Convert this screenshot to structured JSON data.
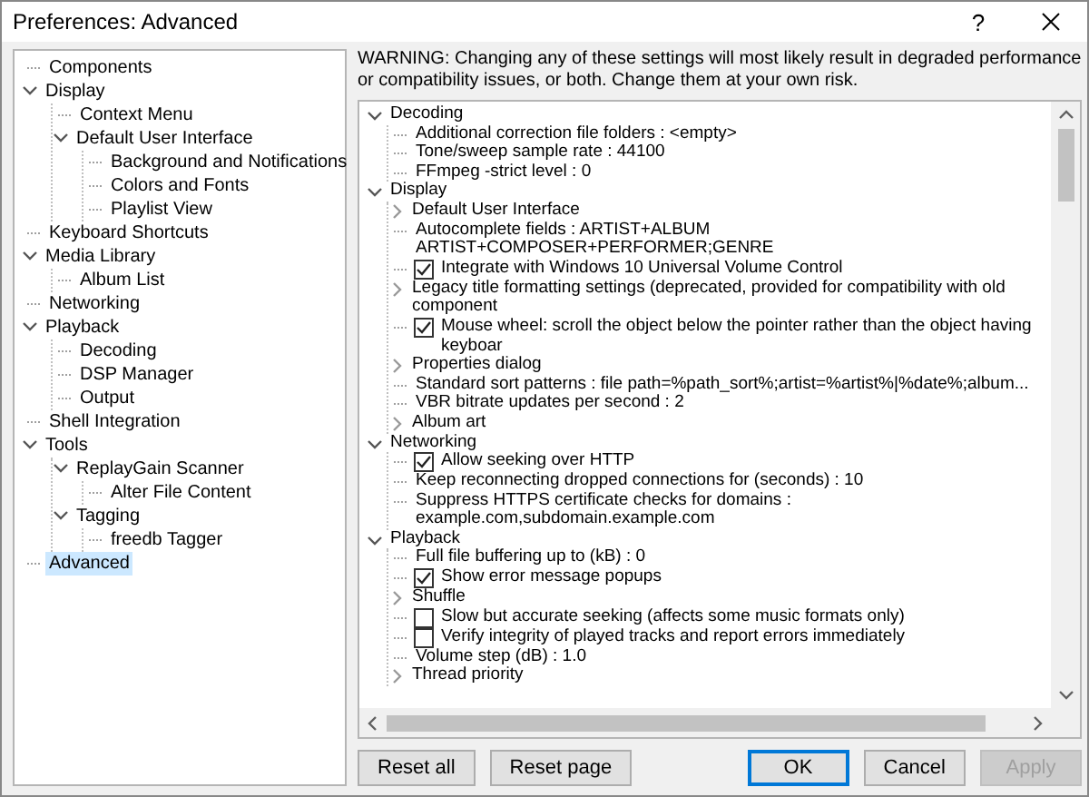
{
  "window": {
    "title": "Preferences: Advanced",
    "help_label": "?"
  },
  "sidebar": {
    "items": [
      {
        "label": "Components",
        "selected": false
      },
      {
        "label": "Display",
        "selected": false,
        "expanded": true,
        "children": [
          {
            "label": "Context Menu",
            "selected": false
          },
          {
            "label": "Default User Interface",
            "selected": false,
            "expanded": true,
            "children": [
              {
                "label": "Background and Notifications",
                "selected": false
              },
              {
                "label": "Colors and Fonts",
                "selected": false
              },
              {
                "label": "Playlist View",
                "selected": false
              }
            ]
          }
        ]
      },
      {
        "label": "Keyboard Shortcuts",
        "selected": false
      },
      {
        "label": "Media Library",
        "selected": false,
        "expanded": true,
        "children": [
          {
            "label": "Album List",
            "selected": false
          }
        ]
      },
      {
        "label": "Networking",
        "selected": false
      },
      {
        "label": "Playback",
        "selected": false,
        "expanded": true,
        "children": [
          {
            "label": "Decoding",
            "selected": false
          },
          {
            "label": "DSP Manager",
            "selected": false
          },
          {
            "label": "Output",
            "selected": false
          }
        ]
      },
      {
        "label": "Shell Integration",
        "selected": false
      },
      {
        "label": "Tools",
        "selected": false,
        "expanded": true,
        "children": [
          {
            "label": "ReplayGain Scanner",
            "selected": false,
            "expanded": true,
            "children": [
              {
                "label": "Alter File Content",
                "selected": false
              }
            ]
          },
          {
            "label": "Tagging",
            "selected": false,
            "expanded": true,
            "children": [
              {
                "label": "freedb Tagger",
                "selected": false
              }
            ]
          }
        ]
      },
      {
        "label": "Advanced",
        "selected": true
      }
    ]
  },
  "warning": "WARNING: Changing any of these settings will most likely result in degraded performance or compatibility issues, or both. Change them at your own risk.",
  "settings": {
    "items": [
      {
        "kind": "branch",
        "label": "Decoding",
        "expanded": true,
        "children": [
          {
            "kind": "text",
            "label": "Additional correction file folders : <empty>"
          },
          {
            "kind": "text",
            "label": "Tone/sweep sample rate : 44100"
          },
          {
            "kind": "text",
            "label": "FFmpeg -strict level : 0"
          }
        ]
      },
      {
        "kind": "branch",
        "label": "Display",
        "expanded": true,
        "children": [
          {
            "kind": "branch",
            "label": "Default User Interface",
            "expanded": false
          },
          {
            "kind": "text",
            "label": "Autocomplete fields : ARTIST+ALBUM ARTIST+COMPOSER+PERFORMER;GENRE"
          },
          {
            "kind": "checkbox",
            "label": "Integrate with Windows 10 Universal Volume Control",
            "checked": true
          },
          {
            "kind": "branch",
            "label": "Legacy title formatting settings (deprecated, provided for compatibility with old component",
            "expanded": false
          },
          {
            "kind": "checkbox",
            "label": "Mouse wheel: scroll the object below the pointer rather than the object having keyboar",
            "checked": true
          },
          {
            "kind": "branch",
            "label": "Properties dialog",
            "expanded": false
          },
          {
            "kind": "text",
            "label": "Standard sort patterns : file path=%path_sort%;artist=%artist%|%date%;album..."
          },
          {
            "kind": "text",
            "label": "VBR bitrate updates per second : 2"
          },
          {
            "kind": "branch",
            "label": "Album art",
            "expanded": false
          }
        ]
      },
      {
        "kind": "branch",
        "label": "Networking",
        "expanded": true,
        "children": [
          {
            "kind": "checkbox",
            "label": "Allow seeking over HTTP",
            "checked": true
          },
          {
            "kind": "text",
            "label": "Keep reconnecting dropped connections for (seconds) : 10"
          },
          {
            "kind": "text",
            "label": "Suppress HTTPS certificate checks for domains : example.com,subdomain.example.com"
          }
        ]
      },
      {
        "kind": "branch",
        "label": "Playback",
        "expanded": true,
        "children": [
          {
            "kind": "text",
            "label": "Full file buffering up to (kB) : 0"
          },
          {
            "kind": "checkbox",
            "label": "Show error message popups",
            "checked": true
          },
          {
            "kind": "branch",
            "label": "Shuffle",
            "expanded": false
          },
          {
            "kind": "checkbox",
            "label": "Slow but accurate seeking (affects some music formats only)",
            "checked": false
          },
          {
            "kind": "checkbox",
            "label": "Verify integrity of played tracks and report errors immediately",
            "checked": false
          },
          {
            "kind": "text",
            "label": "Volume step (dB) : 1.0"
          },
          {
            "kind": "branch",
            "label": "Thread priority",
            "expanded": false
          }
        ]
      }
    ]
  },
  "buttons": [
    {
      "label": "Reset all",
      "default": false,
      "disabled": false
    },
    {
      "label": "Reset page",
      "default": false,
      "disabled": false
    },
    {
      "label": "OK",
      "default": true,
      "disabled": false
    },
    {
      "label": "Cancel",
      "default": false,
      "disabled": false
    },
    {
      "label": "Apply",
      "default": false,
      "disabled": true
    }
  ]
}
